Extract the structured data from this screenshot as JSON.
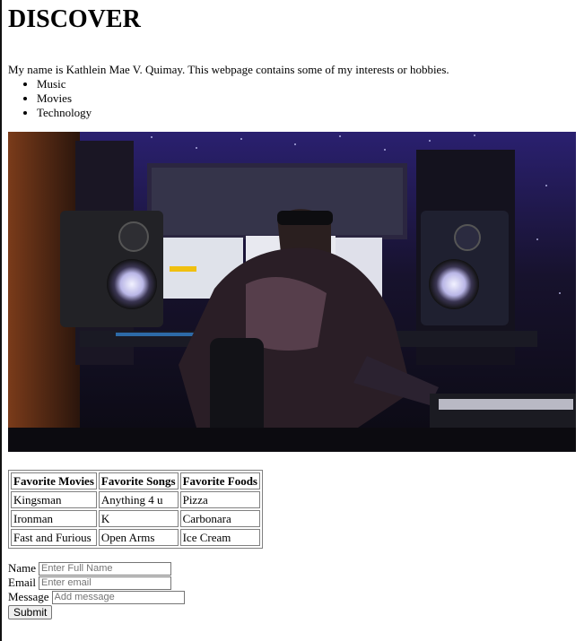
{
  "page": {
    "title": "DISCOVER",
    "intro": "My name is Kathlein Mae V. Quimay. This webpage contains some of my interests or hobbies.",
    "hobbies": [
      "Music",
      "Movies",
      "Technology"
    ]
  },
  "table": {
    "headers": [
      "Favorite Movies",
      "Favorite Songs",
      "Favorite Foods"
    ],
    "rows": [
      [
        "Kingsman",
        "Anything 4 u",
        "Pizza"
      ],
      [
        "Ironman",
        "K",
        "Carbonara"
      ],
      [
        "Fast and Furious",
        "Open Arms",
        "Ice Cream"
      ]
    ]
  },
  "form": {
    "name_label": "Name",
    "name_placeholder": "Enter Full Name",
    "email_label": "Email",
    "email_placeholder": "Enter email",
    "message_label": "Message",
    "message_placeholder": "Add message",
    "submit_label": "Submit"
  }
}
